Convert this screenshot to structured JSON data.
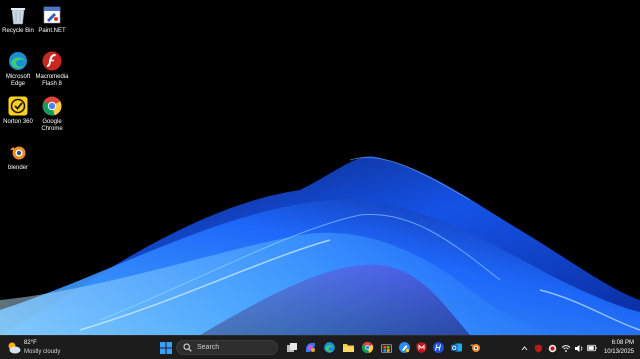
{
  "desktop": {
    "icons": [
      {
        "label": "Recycle Bin",
        "icon": "recycle-bin-icon"
      },
      {
        "label": "Paint.NET",
        "icon": "paint-net-icon"
      },
      {
        "label": "Microsoft Edge",
        "icon": "edge-icon"
      },
      {
        "label": "Macromedia Flash 8",
        "icon": "flash-icon"
      },
      {
        "label": "Norton 360",
        "icon": "norton-icon"
      },
      {
        "label": "Google Chrome",
        "icon": "chrome-icon"
      },
      {
        "label": "blender",
        "icon": "blender-icon"
      }
    ]
  },
  "taskbar": {
    "weather": {
      "temp": "82°F",
      "condition": "Mostly cloudy"
    },
    "search_placeholder": "Search",
    "clock": {
      "time": "6:08 PM",
      "date": "10/13/2025"
    },
    "pinned": [
      "start-icon",
      "search-icon",
      "task-view-icon",
      "copilot-icon",
      "edge-icon",
      "file-explorer-icon",
      "chrome-icon",
      "store-icon",
      "paint-net-icon",
      "mcafee-icon",
      "hp-icon",
      "outlook-icon",
      "blender-icon"
    ],
    "tray": [
      "chevron-up-icon",
      "security-icon",
      "app-icon",
      "wifi-icon",
      "volume-icon",
      "battery-icon"
    ]
  },
  "colors": {
    "taskbar": "#1c1c1c",
    "accent": "#1a6fff",
    "desktop": "#000000"
  }
}
